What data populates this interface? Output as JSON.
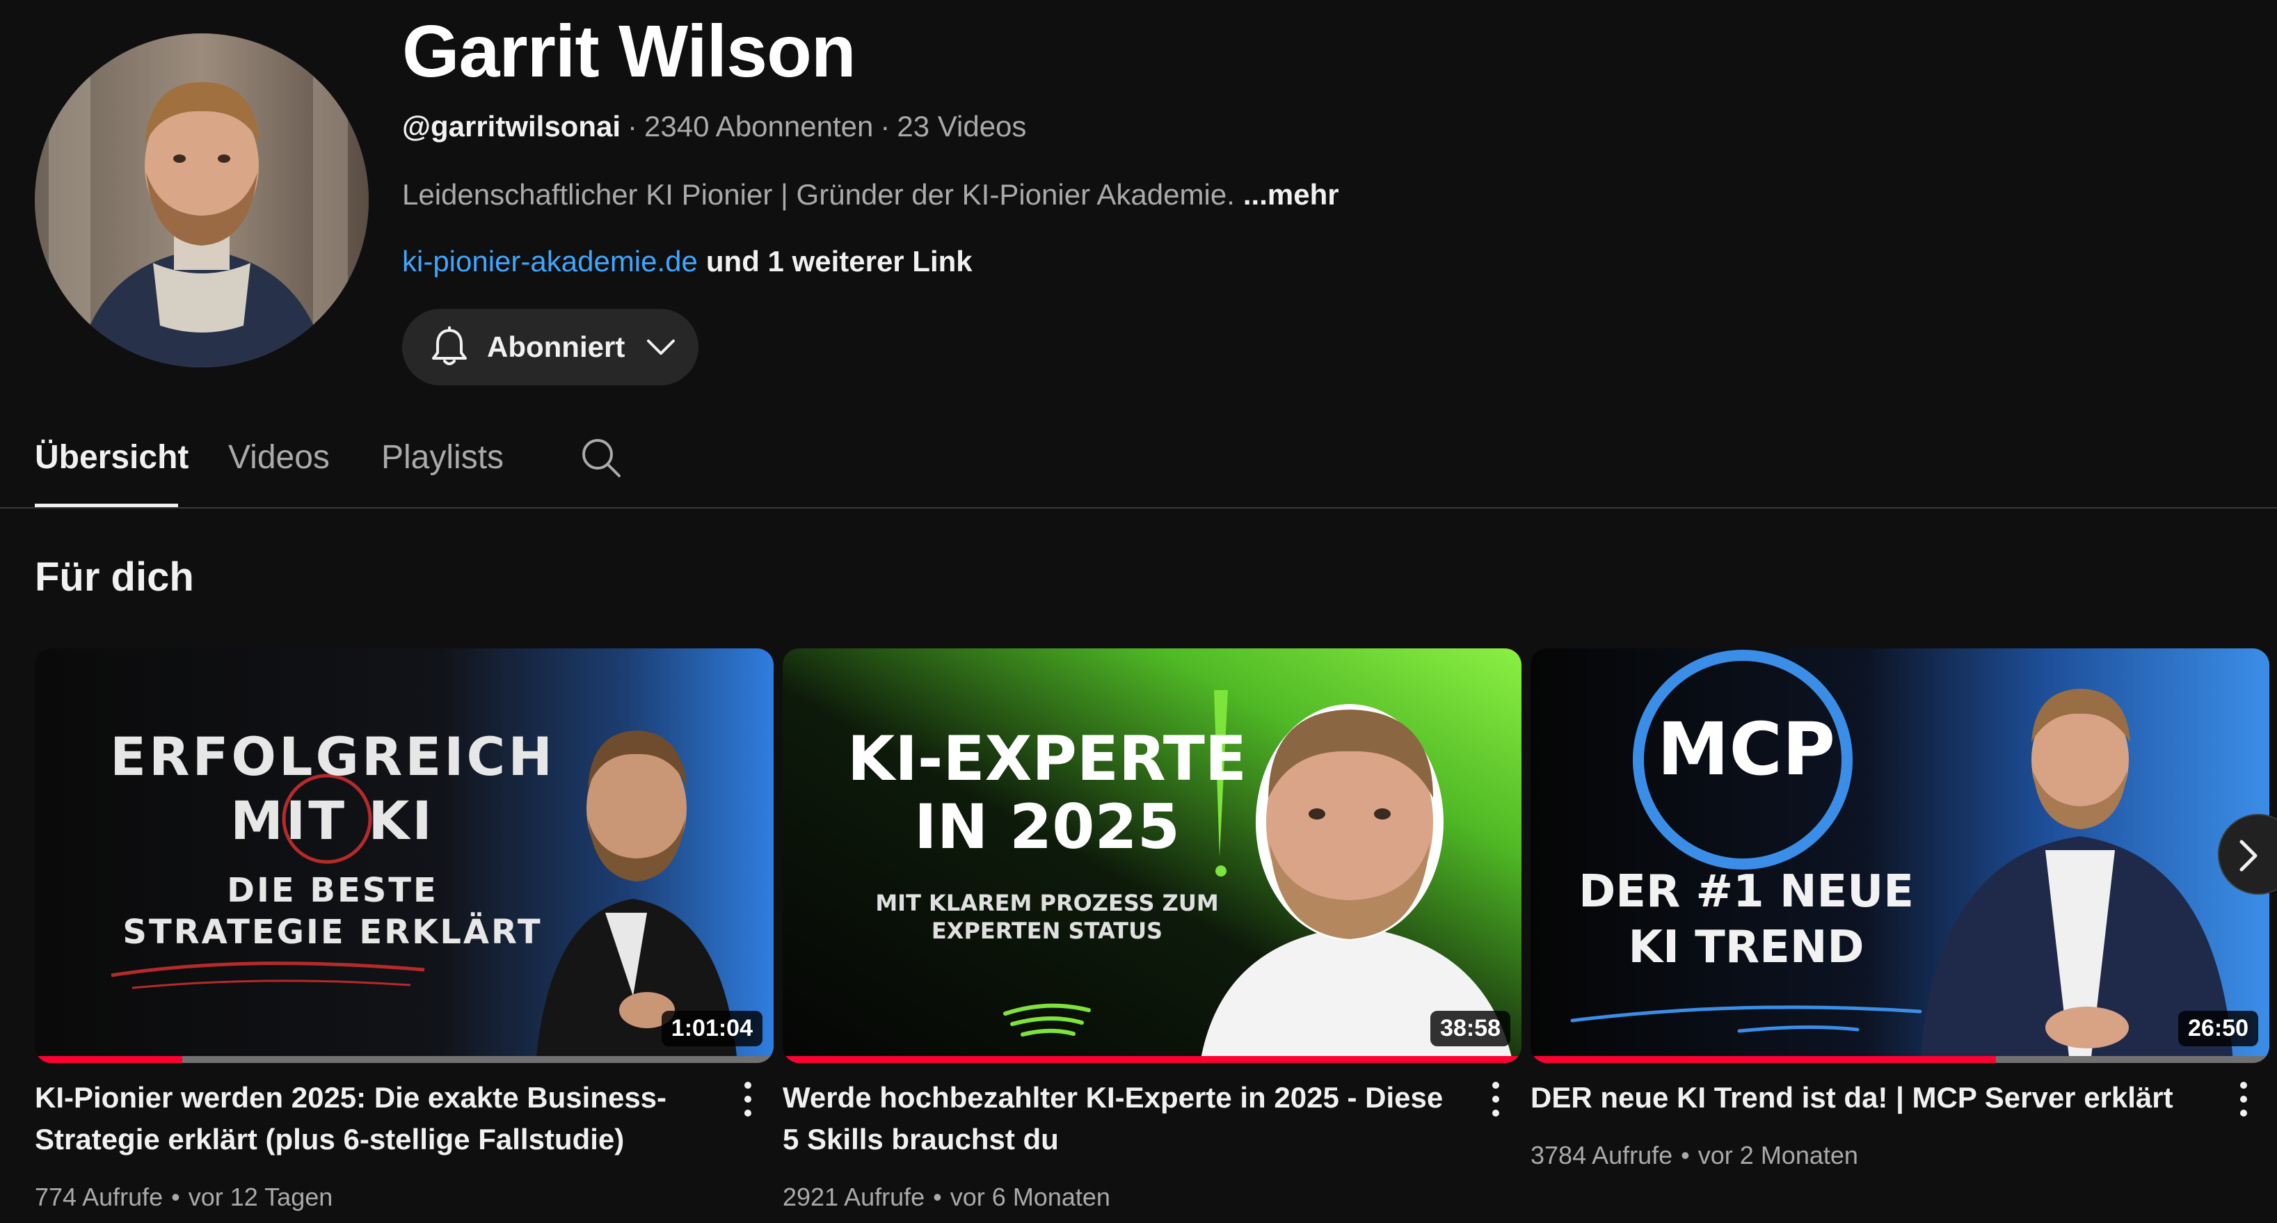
{
  "channel": {
    "name": "Garrit Wilson",
    "handle": "@garritwilsonai",
    "subscribers": "2340 Abonnenten",
    "videos_count": "23 Videos",
    "meta_separator": "·",
    "description": "Leidenschaftlicher KI Pionier | Gründer der KI-Pionier Akademie.",
    "description_more": "...mehr",
    "link_text": "ki-pionier-akademie.de",
    "more_links": "und 1 weiterer Link",
    "subscribe_label": "Abonniert"
  },
  "tabs": [
    {
      "label": "Übersicht",
      "active": true
    },
    {
      "label": "Videos",
      "active": false
    },
    {
      "label": "Playlists",
      "active": false
    }
  ],
  "section": {
    "title": "Für dich"
  },
  "videos": [
    {
      "title": "KI-Pionier werden 2025: Die exakte Business-Strategie erklärt (plus 6-stellige Fallstudie)",
      "duration": "1:01:04",
      "views": "774 Aufrufe",
      "age": "vor 12 Tagen",
      "watched_fraction": 0.2,
      "thumb_lines": [
        "ERFOLGREICH",
        "MIT KI",
        "DIE BESTE",
        "STRATEGIE ERKLÄRT"
      ]
    },
    {
      "title": "Werde hochbezahlter KI-Experte in 2025 - Diese 5 Skills brauchst du",
      "duration": "38:58",
      "views": "2921 Aufrufe",
      "age": "vor 6 Monaten",
      "watched_fraction": 1.0,
      "thumb_lines": [
        "KI-EXPERTE",
        "IN 2025",
        "MIT KLAREM PROZESS ZUM",
        "EXPERTEN STATUS"
      ]
    },
    {
      "title": "DER neue KI Trend ist da! | MCP Server erklärt",
      "duration": "26:50",
      "views": "3784 Aufrufe",
      "age": "vor 2 Monaten",
      "watched_fraction": 0.63,
      "thumb_lines": [
        "MCP",
        "DER #1 NEUE",
        "KI TREND"
      ]
    }
  ],
  "meta_dot": "•",
  "colors": {
    "background": "#0f0f0f",
    "link": "#3ea6ff",
    "progress": "#ff0033",
    "green_accent": "#7ee33a",
    "blue_accent": "#3b8ee8"
  }
}
